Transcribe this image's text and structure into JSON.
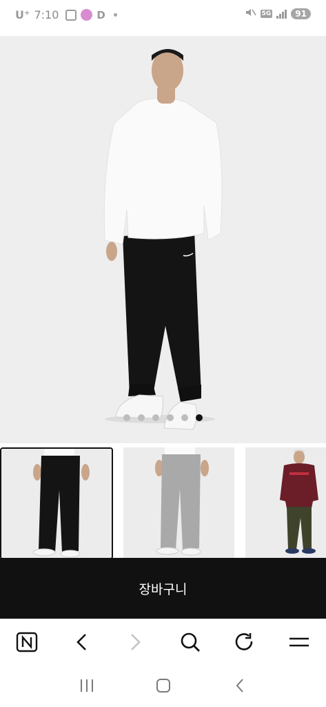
{
  "status_bar": {
    "carrier": "U⁺",
    "time": "7:10",
    "network": "5G",
    "battery": "91"
  },
  "product": {
    "carousel": {
      "total": 6,
      "active_index": 5
    },
    "thumbnails": [
      {
        "name": "black-pants",
        "selected": true
      },
      {
        "name": "grey-pants",
        "selected": false
      },
      {
        "name": "olive-pants-with-maroon-top",
        "selected": false
      }
    ]
  },
  "cart": {
    "label": "장바구니"
  },
  "browser_toolbar": {
    "icons": [
      "naver-home-icon",
      "back-arrow-icon",
      "forward-arrow-icon",
      "search-icon",
      "refresh-icon",
      "menu-icon"
    ]
  },
  "system_nav": {
    "icons": [
      "recent-apps-icon",
      "home-icon",
      "back-icon"
    ]
  },
  "colors": {
    "cart_background": "#111111",
    "hero_background": "#eeeeee",
    "dot_active": "#111111",
    "dot_inactive": "#bdbdbd"
  }
}
